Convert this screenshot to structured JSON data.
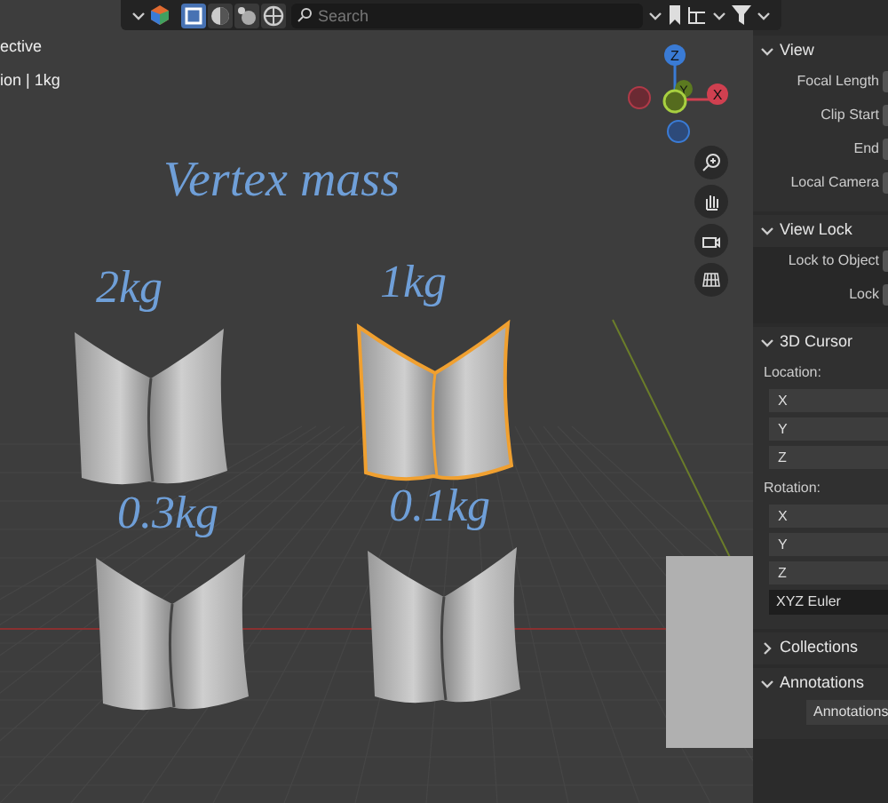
{
  "header": {
    "shading_modes": [
      {
        "kind": "wireframe",
        "selected": true
      },
      {
        "kind": "solid",
        "selected": false
      },
      {
        "kind": "material",
        "selected": false
      },
      {
        "kind": "rendered",
        "selected": false
      }
    ],
    "search": {
      "placeholder": "Search"
    }
  },
  "viewport": {
    "overlay_text": [
      "ective",
      "ion | 1kg"
    ],
    "title_note": "Vertex mass",
    "gizmo_axes": [
      "Z",
      "Y",
      "X"
    ],
    "objects": [
      {
        "label": "2kg",
        "selected": false
      },
      {
        "label": "1kg",
        "selected": true
      },
      {
        "label": "0.3kg",
        "selected": false
      },
      {
        "label": "0.1kg",
        "selected": false
      }
    ]
  },
  "sidebar": {
    "sections": [
      {
        "title": "View",
        "expanded": true,
        "rows": [
          {
            "kind": "field",
            "label": "Focal Length"
          },
          {
            "kind": "field",
            "label": "Clip Start"
          },
          {
            "kind": "field",
            "label": "End"
          },
          {
            "kind": "field",
            "label": "Local Camera"
          }
        ]
      },
      {
        "title": "View Lock",
        "expanded": true,
        "rows": [
          {
            "kind": "field",
            "label": "Lock to Object"
          },
          {
            "kind": "field",
            "label": "Lock"
          }
        ]
      },
      {
        "title": "3D Cursor",
        "expanded": true,
        "rows": [
          {
            "kind": "heading",
            "label": "Location:"
          },
          {
            "kind": "axis",
            "label": "X"
          },
          {
            "kind": "axis",
            "label": "Y"
          },
          {
            "kind": "axis",
            "label": "Z"
          },
          {
            "kind": "heading",
            "label": "Rotation:"
          },
          {
            "kind": "axis",
            "label": "X"
          },
          {
            "kind": "axis",
            "label": "Y"
          },
          {
            "kind": "axis",
            "label": "Z"
          },
          {
            "kind": "dropdown",
            "label": "XYZ Euler"
          }
        ]
      },
      {
        "title": "Collections",
        "expanded": false
      },
      {
        "title": "Annotations",
        "expanded": true,
        "rows": [
          {
            "kind": "layer",
            "label": "Annotations"
          }
        ]
      }
    ]
  }
}
